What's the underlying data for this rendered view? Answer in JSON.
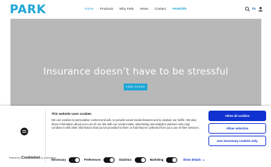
{
  "header": {
    "logo": "PARK",
    "nav": [
      {
        "label": "Home",
        "active": true
      },
      {
        "label": "Products"
      },
      {
        "label": "Why Park"
      },
      {
        "label": "News"
      },
      {
        "label": "Contact"
      },
      {
        "label": "PARKlife"
      }
    ],
    "icons": [
      "search-icon",
      "linkedin-icon",
      "user-icon"
    ],
    "linkedin_text": "in"
  },
  "hero": {
    "title": "Insurance doesn’t have to be stressful",
    "button": "FIND COVER",
    "background_color": "#b8b8b8",
    "button_color": "#1fa6d6"
  },
  "cookie_banner": {
    "title": "This website uses cookies",
    "text": "We use cookies to personalise content and ads, to provide social media features and to analyse our traffic. We also share information about your use of our site with our social media, advertising and analytics partners who may combine it with other information that you’ve provided to them or that they’ve collected from your use of their services.",
    "powered_by": "Powered by",
    "brand": "Cookiebot",
    "brand_sub": "by Usercentrics",
    "toggles": [
      {
        "label": "Necessary",
        "on": true
      },
      {
        "label": "Preferences",
        "on": true
      },
      {
        "label": "Statistics",
        "on": true
      },
      {
        "label": "Marketing",
        "on": true
      }
    ],
    "show_details": "Show details",
    "buttons": {
      "allow_all": "Allow all cookies",
      "allow_selection": "Allow selection",
      "necessary_only": "Use necessary cookies only"
    },
    "accent_color": "#1032cf"
  }
}
